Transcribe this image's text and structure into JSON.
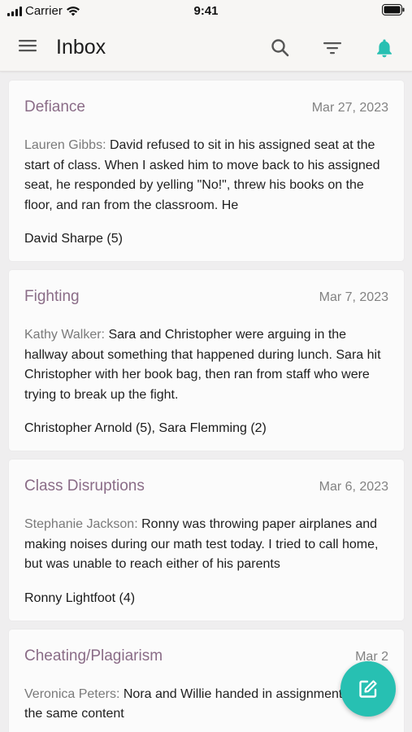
{
  "status_bar": {
    "carrier": "Carrier",
    "time": "9:41"
  },
  "header": {
    "title": "Inbox"
  },
  "colors": {
    "accent": "#27c0b2",
    "card_title": "#8a6c87",
    "background": "#efeeef"
  },
  "icons": {
    "menu": "hamburger-menu-icon",
    "search": "search-icon",
    "filter": "filter-icon",
    "notifications": "bell-icon",
    "compose": "compose-icon"
  },
  "incidents": [
    {
      "title": "Defiance",
      "date": "Mar 27, 2023",
      "reporter": "Lauren Gibbs:",
      "text": "David refused to sit in his assigned seat at the start of class. When I asked him to move back to his assigned seat, he responded by yelling \"No!\", threw his books on the floor, and ran from the classroom. He",
      "students": "David Sharpe (5)"
    },
    {
      "title": "Fighting",
      "date": "Mar 7, 2023",
      "reporter": "Kathy Walker:",
      "text": "Sara and Christopher were arguing in the hallway about something that happened during lunch. Sara hit Christopher with her book bag, then ran from staff who were trying to break up the fight.",
      "students": "Christopher Arnold (5), Sara Flemming (2)"
    },
    {
      "title": "Class Disruptions",
      "date": "Mar 6, 2023",
      "reporter": "Stephanie Jackson:",
      "text": "Ronny was throwing paper airplanes and making noises during our math test today. I tried to call home, but was unable to reach either of his parents",
      "students": "Ronny Lightfoot (4)"
    },
    {
      "title": "Cheating/Plagiarism",
      "date": "Mar 2",
      "reporter": "Veronica Peters:",
      "text": "Nora and Willie handed in assignments with the same content",
      "students": ""
    }
  ]
}
